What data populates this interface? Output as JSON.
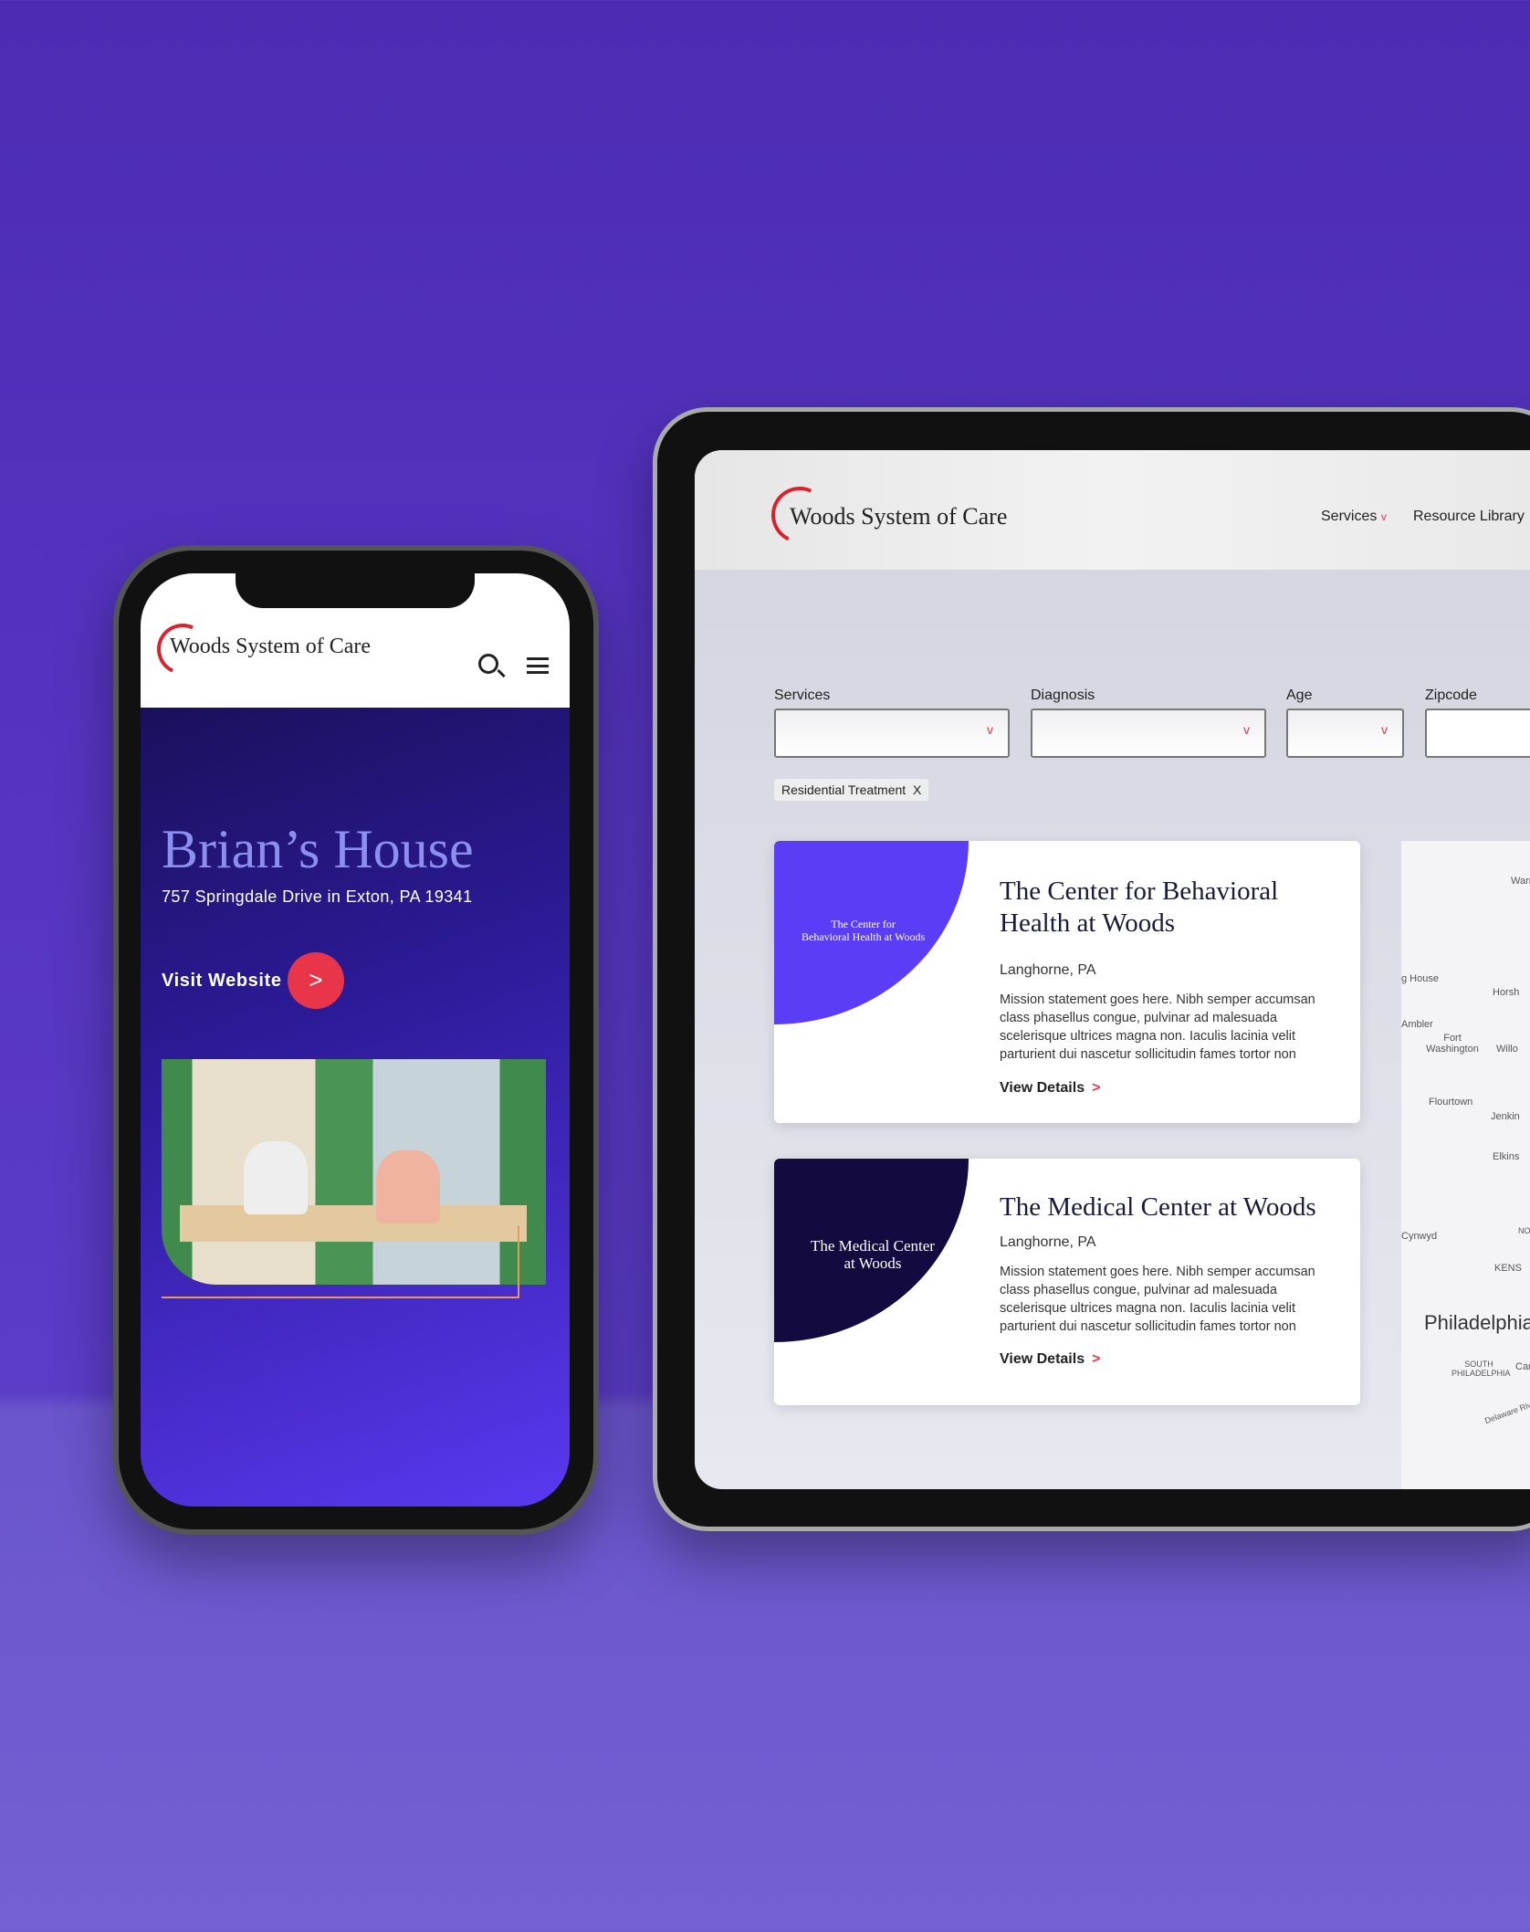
{
  "phone": {
    "brand": "Woods System of Care",
    "search_icon": "search-icon",
    "menu_icon": "hamburger-menu-icon",
    "title": "Brian’s House",
    "address": "757 Springdale Drive in Exton, PA 19341",
    "visit_label": "Visit Website",
    "visit_icon": ">"
  },
  "tablet": {
    "brand": "Woods System of Care",
    "nav": [
      {
        "label": "Services",
        "chevron": "v"
      },
      {
        "label": "Resource Library"
      }
    ],
    "filters": [
      {
        "label": "Services",
        "value": ""
      },
      {
        "label": "Diagnosis",
        "value": ""
      },
      {
        "label": "Age",
        "value": ""
      },
      {
        "label": "Zipcode",
        "value": ""
      }
    ],
    "chip": {
      "label": "Residential Treatment",
      "close": "X"
    },
    "cards": [
      {
        "logo_line1": "The Center for",
        "logo_line2": "Behavioral Health at Woods",
        "title": "The Center for Behavioral Health at Woods",
        "location": "Langhorne, PA",
        "description": "Mission statement goes here. Nibh semper accumsan class phasellus congue, pulvinar ad malesuada scelerisque ultrices magna non. Iaculis lacinia velit parturient dui nascetur sollicitudin fames tortor non",
        "link": "View Details",
        "color": "#5b3df5"
      },
      {
        "logo_line1": "The Medical Center",
        "logo_line2": "at Woods",
        "title": "The Medical Center at Woods",
        "location": "Langhorne, PA",
        "description": "Mission statement goes here. Nibh semper accumsan class phasellus congue, pulvinar ad malesuada scelerisque ultrices magna non. Iaculis lacinia velit parturient dui nascetur sollicitudin fames tortor non",
        "link": "View Details",
        "color": "#130b3f"
      }
    ],
    "map_labels": [
      "Warringt",
      "g House",
      "Horsh",
      "Ambler",
      "Fort Washington",
      "Willo",
      "Flourtown",
      "Jenkin",
      "Elkins",
      "Cynwyd",
      "NORTH PHILADEL",
      "KENS",
      "Philadelphia",
      "SOUTH PHILADELPHIA",
      "Car",
      "Delaware River"
    ]
  },
  "colors": {
    "accent": "#e8354a",
    "brand_purple": "#5b3df5",
    "brand_navy": "#130b3f"
  }
}
